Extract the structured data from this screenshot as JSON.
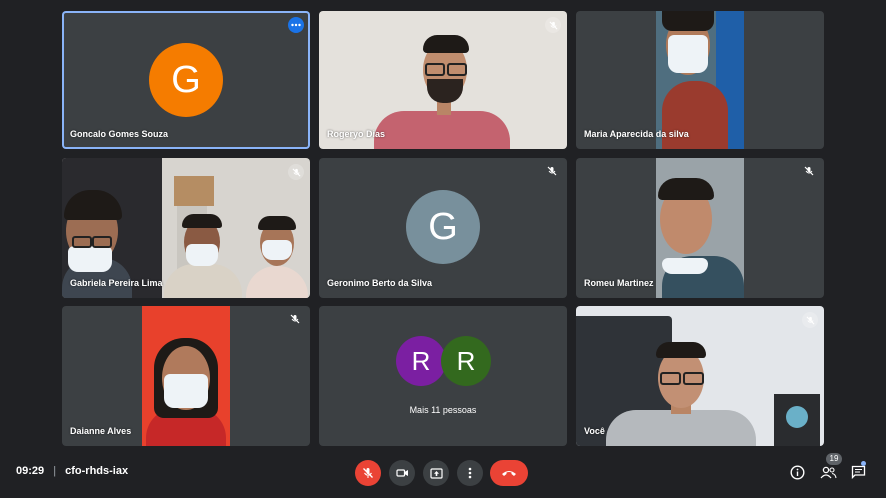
{
  "tiles": [
    {
      "name": "Goncalo Gomes Souza",
      "initial": "G",
      "avatar_color": "#f57c00"
    },
    {
      "name": "Rogeryo Dias"
    },
    {
      "name": "Maria Aparecida da silva"
    },
    {
      "name": "Gabriela Pereira Lima"
    },
    {
      "name": "Geronimo Berto da Silva",
      "initial": "G",
      "avatar_color": "#78909c"
    },
    {
      "name": "Romeu Martinez"
    },
    {
      "name": "Daianne Alves"
    },
    {
      "overflow_label": "Mais 11 pessoas",
      "initials": [
        "R",
        "R"
      ],
      "colors": [
        "#7b1fa2",
        "#33691e"
      ]
    },
    {
      "name": "Você"
    }
  ],
  "bottom_bar": {
    "time": "09:29",
    "separator": "|",
    "meeting_code": "cfo-rhds-iax",
    "participants_count": "19"
  },
  "colors": {
    "background": "#202124",
    "tile": "#3c4043",
    "active_border": "#8ab4f8",
    "end_call": "#ea4335"
  },
  "icons": [
    "more-options-icon",
    "mic-off-icon",
    "camera-icon",
    "present-icon",
    "more-vert-icon",
    "end-call-icon",
    "info-icon",
    "people-icon",
    "chat-icon"
  ]
}
